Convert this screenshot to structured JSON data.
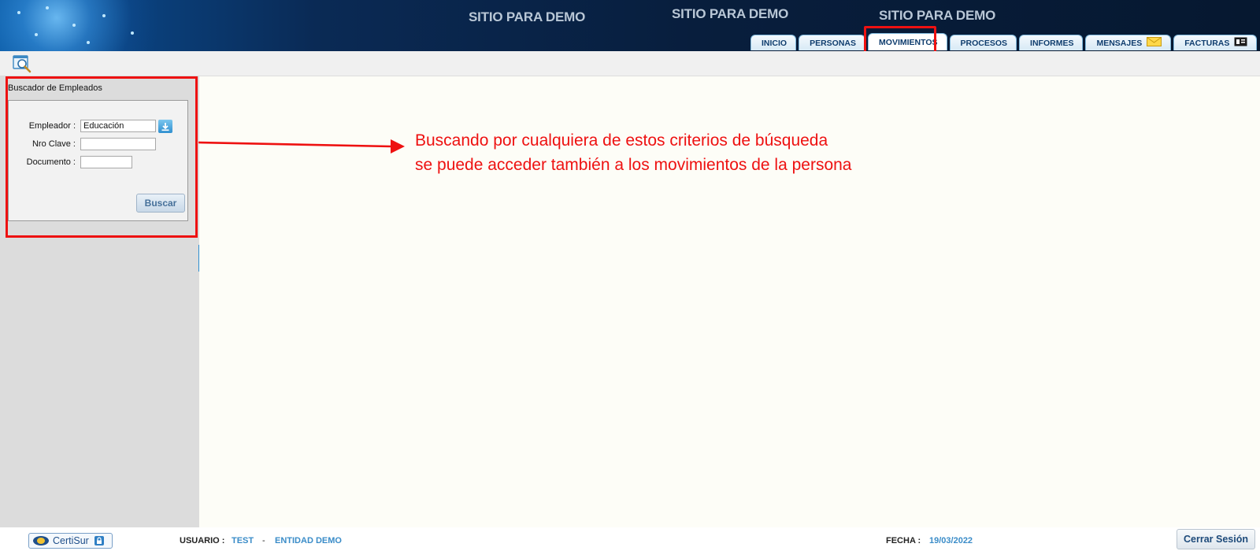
{
  "header": {
    "site_titles": [
      "SITIO PARA DEMO",
      "SITIO PARA DEMO",
      "SITIO PARA DEMO"
    ],
    "tabs": [
      {
        "label": "INICIO",
        "active": false
      },
      {
        "label": "PERSONAS",
        "active": false
      },
      {
        "label": "MOVIMIENTOS",
        "active": true
      },
      {
        "label": "PROCESOS",
        "active": false
      },
      {
        "label": "INFORMES",
        "active": false
      },
      {
        "label": "MENSAJES",
        "active": false,
        "icon": "envelope-icon"
      },
      {
        "label": "FACTURAS",
        "active": false,
        "icon": "invoice-icon"
      }
    ]
  },
  "toolbar": {
    "icon": "search-window-icon"
  },
  "sidebar": {
    "panel_title": "Buscador de Empleados",
    "fields": {
      "empleador_label": "Empleador :",
      "empleador_value": "Educación",
      "clave_label": "Nro Clave :",
      "clave_value": "",
      "documento_label": "Documento :",
      "documento_value": ""
    },
    "search_button": "Buscar"
  },
  "annotation": {
    "line1": "Buscando por cualquiera de estos criterios de búsqueda",
    "line2": "se puede acceder también a los movimientos de la persona"
  },
  "footer": {
    "logo_text": "CertiSur",
    "usuario_label": "USUARIO :",
    "usuario_value": "TEST",
    "separator": "-",
    "entidad_value": "ENTIDAD DEMO",
    "fecha_label": "FECHA :",
    "fecha_value": "19/03/2022",
    "logout_button": "Cerrar Sesión"
  },
  "colors": {
    "accent": "#3a8cc8",
    "highlight": "#ee1111",
    "header_bg": "#0a2a55"
  }
}
